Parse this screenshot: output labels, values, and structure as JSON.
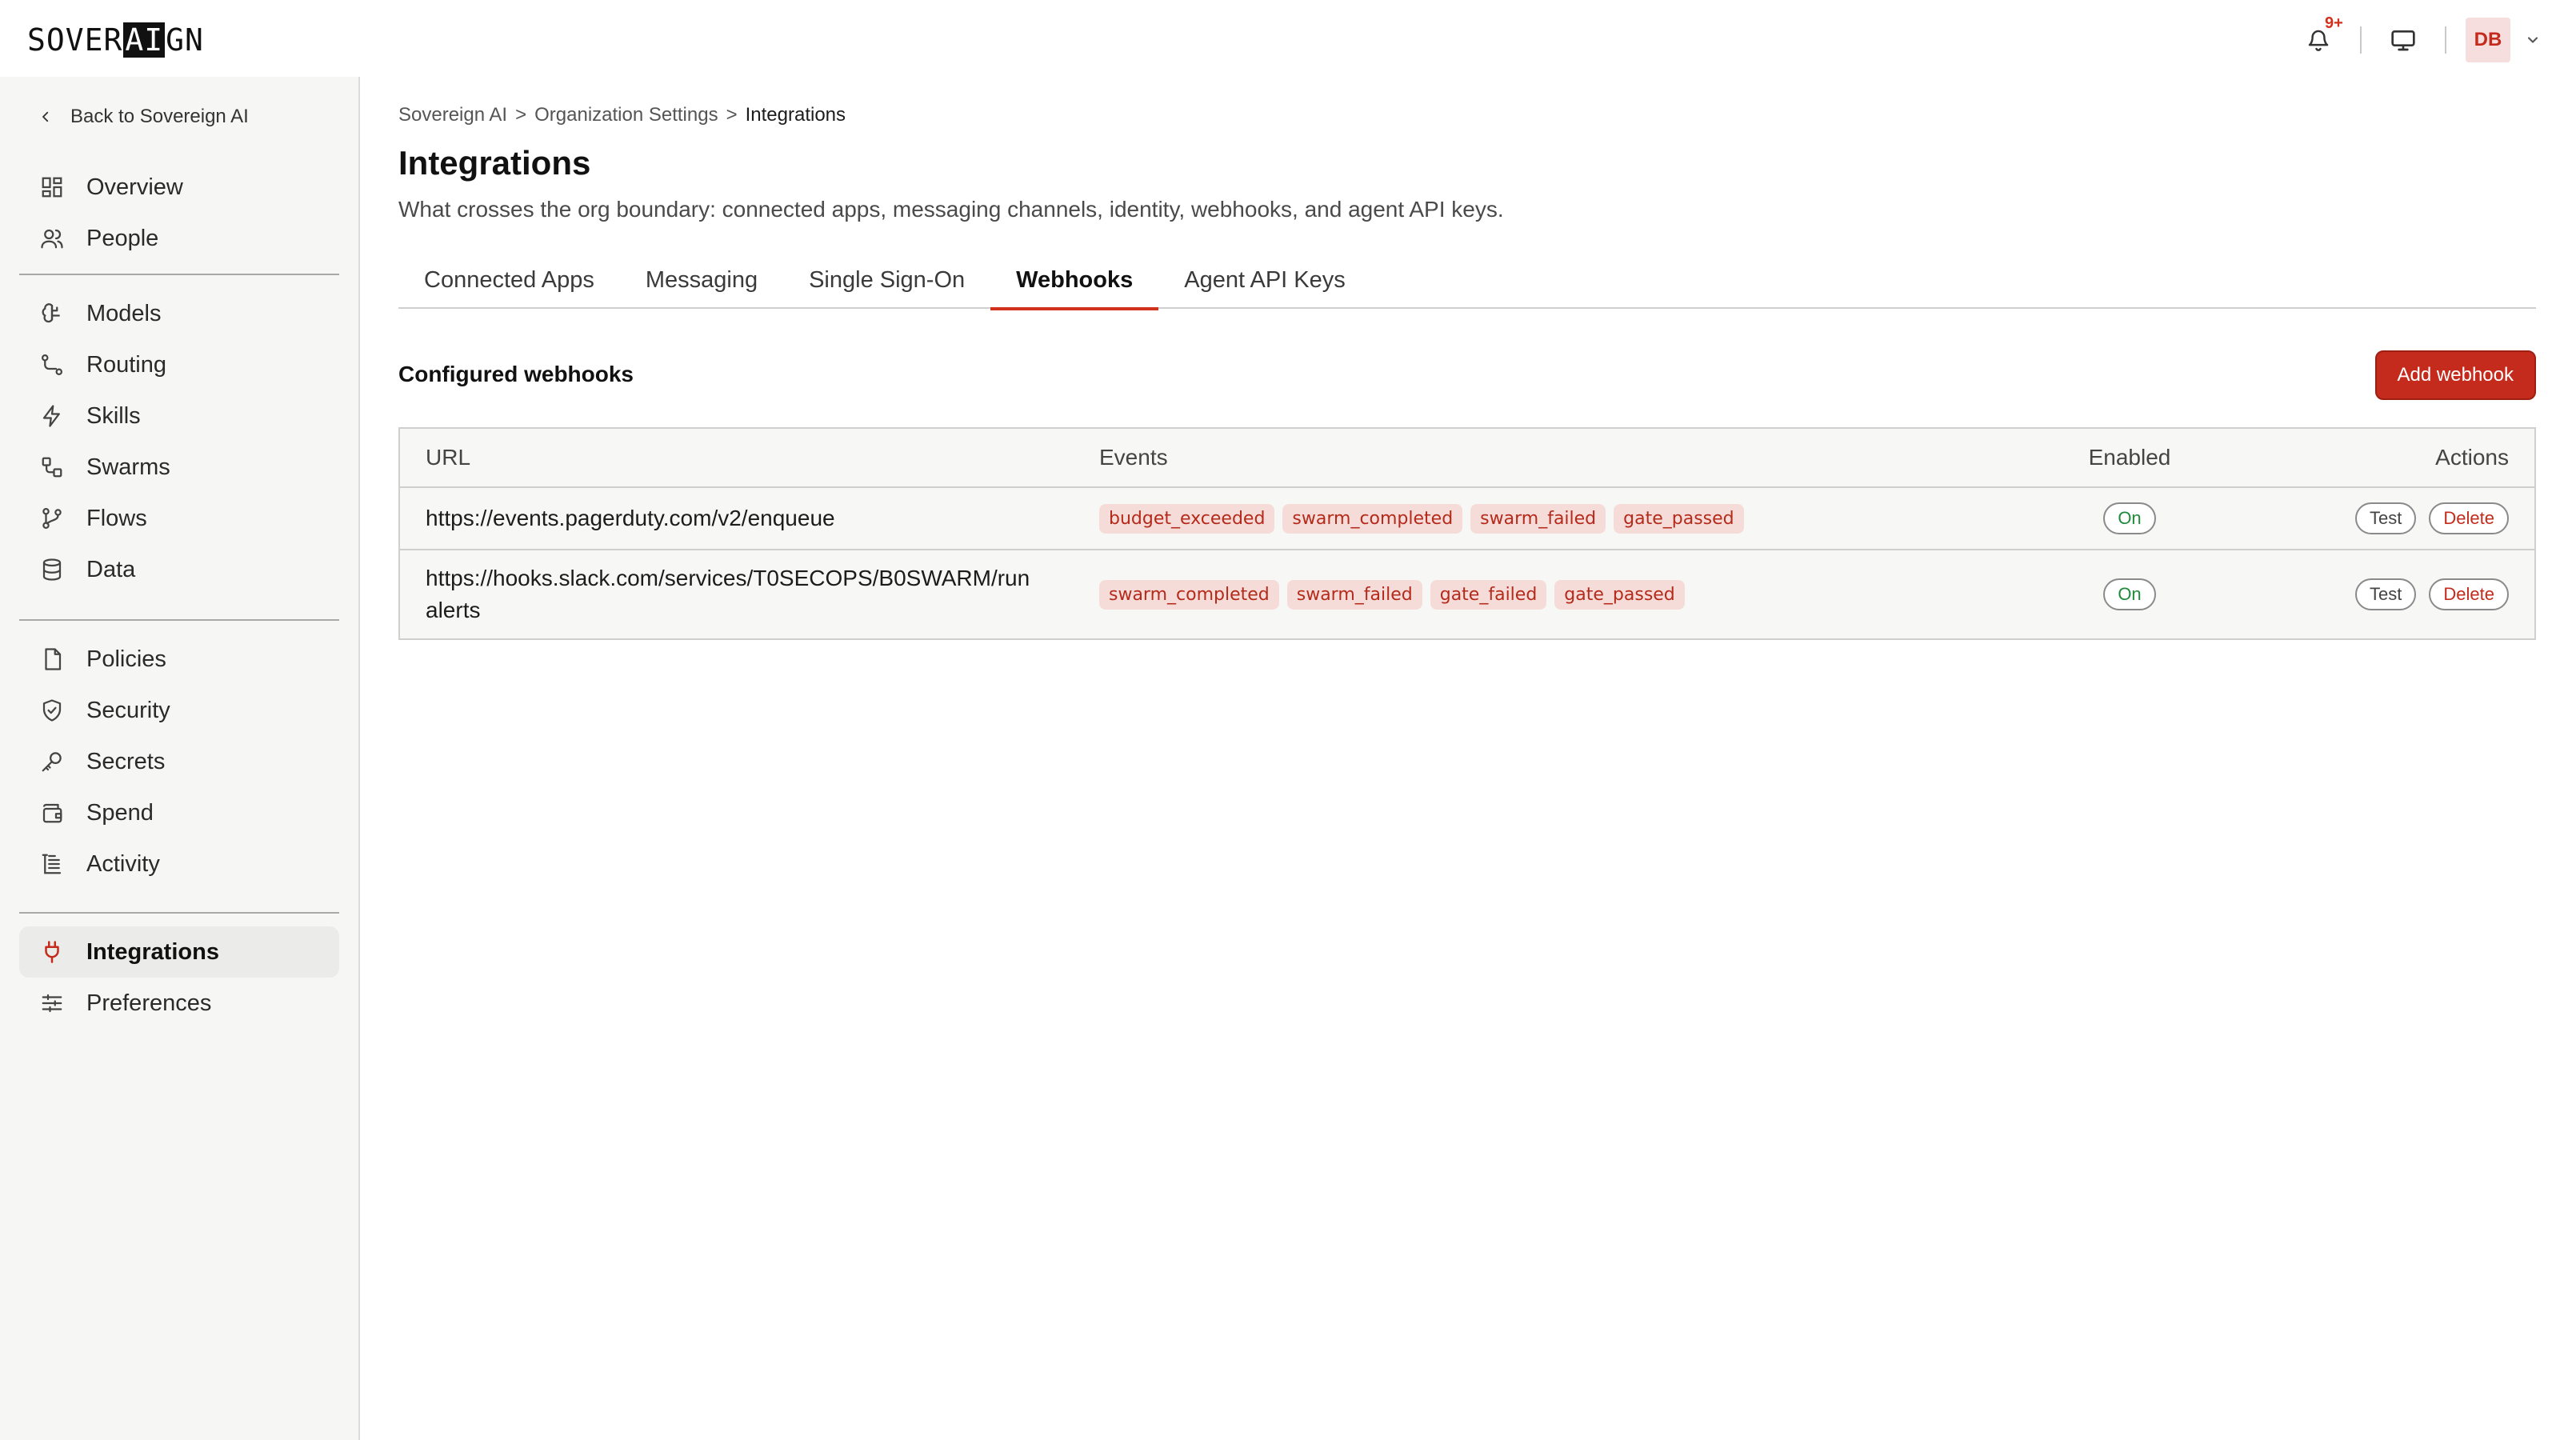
{
  "header": {
    "logo_parts": [
      "SOVER",
      "AI",
      "GN"
    ],
    "notifications_badge": "9+",
    "avatar_initials": "DB"
  },
  "sidebar": {
    "back_label": "Back to Sovereign AI",
    "group1": [
      {
        "label": "Overview",
        "icon": "grid-icon"
      },
      {
        "label": "People",
        "icon": "people-icon"
      }
    ],
    "group2": [
      {
        "label": "Models",
        "icon": "brain-icon"
      },
      {
        "label": "Routing",
        "icon": "route-icon"
      },
      {
        "label": "Skills",
        "icon": "bolt-icon"
      },
      {
        "label": "Swarms",
        "icon": "swarm-icon"
      },
      {
        "label": "Flows",
        "icon": "branch-icon"
      },
      {
        "label": "Data",
        "icon": "database-icon"
      }
    ],
    "group3": [
      {
        "label": "Policies",
        "icon": "document-icon"
      },
      {
        "label": "Security",
        "icon": "shield-icon"
      },
      {
        "label": "Secrets",
        "icon": "key-icon"
      },
      {
        "label": "Spend",
        "icon": "wallet-icon"
      },
      {
        "label": "Activity",
        "icon": "log-icon"
      }
    ],
    "group4": [
      {
        "label": "Integrations",
        "icon": "plug-icon",
        "active": true
      },
      {
        "label": "Preferences",
        "icon": "sliders-icon"
      }
    ]
  },
  "breadcrumb": {
    "items": [
      "Sovereign AI",
      "Organization Settings",
      "Integrations"
    ],
    "separator": ">"
  },
  "page": {
    "title": "Integrations",
    "subtitle": "What crosses the org boundary: connected apps, messaging channels, identity, webhooks, and agent API keys."
  },
  "tabs": [
    {
      "label": "Connected Apps"
    },
    {
      "label": "Messaging"
    },
    {
      "label": "Single Sign-On"
    },
    {
      "label": "Webhooks",
      "active": true
    },
    {
      "label": "Agent API Keys"
    }
  ],
  "webhooks": {
    "section_title": "Configured webhooks",
    "add_label": "Add webhook",
    "columns": {
      "url": "URL",
      "events": "Events",
      "enabled": "Enabled",
      "actions": "Actions"
    },
    "rows": [
      {
        "url": "https://events.pagerduty.com/v2/enqueue",
        "url_cont": "",
        "events": [
          "budget_exceeded",
          "swarm_completed",
          "swarm_failed",
          "gate_passed"
        ],
        "enabled": "On",
        "test_label": "Test",
        "delete_label": "Delete"
      },
      {
        "url": "https://hooks.slack.com/services/T0SECOPS/B0SWARM/run",
        "url_cont": "alerts",
        "events": [
          "swarm_completed",
          "swarm_failed",
          "gate_failed",
          "gate_passed"
        ],
        "enabled": "On",
        "test_label": "Test",
        "delete_label": "Delete"
      }
    ]
  },
  "colors": {
    "accent": "#c42b1c",
    "chip_bg": "#f6dcd8",
    "enabled_green": "#1e8a3a"
  }
}
